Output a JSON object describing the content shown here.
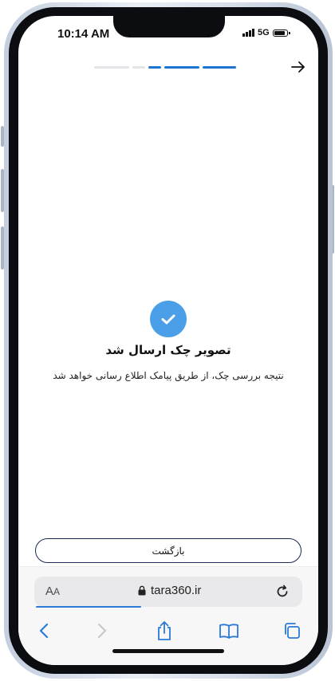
{
  "status_bar": {
    "time": "10:14 AM",
    "network": "5G"
  },
  "wizard": {
    "total_steps": 5,
    "completed_steps": 3
  },
  "success": {
    "title": "تصویر چک ارسال شد",
    "message": "نتیجه بررسی چک، از طریق پیامک اطلاع رسانی خواهد شد"
  },
  "actions": {
    "return_label": "بازگشت"
  },
  "browser": {
    "text_size_label_big": "A",
    "text_size_label_small": "A",
    "domain": "tara360.ir"
  },
  "colors": {
    "accent": "#1f74d1",
    "success_check": "#4a9fe8",
    "button_border": "#1b2a55"
  }
}
